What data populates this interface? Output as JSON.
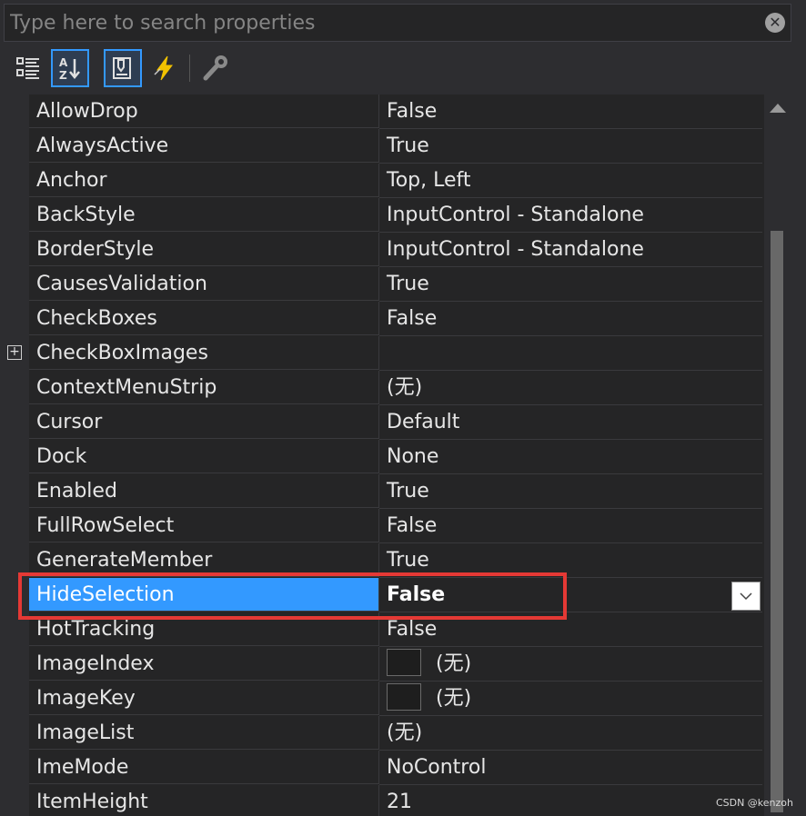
{
  "search": {
    "placeholder": "Type here to search properties"
  },
  "toolbar": {
    "buttons": [
      {
        "icon": "categorized-icon",
        "active": false
      },
      {
        "icon": "alphabetical-sort-icon",
        "active": true
      },
      {
        "icon": "properties-icon",
        "active": true
      },
      {
        "icon": "events-lightning-icon",
        "active": false
      },
      {
        "icon": "property-pages-wrench-icon",
        "active": false
      }
    ]
  },
  "properties": [
    {
      "name": "AllowDrop",
      "value": "False"
    },
    {
      "name": "AlwaysActive",
      "value": "True"
    },
    {
      "name": "Anchor",
      "value": "Top, Left"
    },
    {
      "name": "BackStyle",
      "value": "InputControl - Standalone"
    },
    {
      "name": "BorderStyle",
      "value": "InputControl - Standalone"
    },
    {
      "name": "CausesValidation",
      "value": "True"
    },
    {
      "name": "CheckBoxes",
      "value": "False"
    },
    {
      "name": "CheckBoxImages",
      "value": "",
      "expandable": true
    },
    {
      "name": "ContextMenuStrip",
      "value": "(无)"
    },
    {
      "name": "Cursor",
      "value": "Default"
    },
    {
      "name": "Dock",
      "value": "None"
    },
    {
      "name": "Enabled",
      "value": "True"
    },
    {
      "name": "FullRowSelect",
      "value": "False"
    },
    {
      "name": "GenerateMember",
      "value": "True"
    },
    {
      "name": "HideSelection",
      "value": "False",
      "selected": true
    },
    {
      "name": "HotTracking",
      "value": "False"
    },
    {
      "name": "ImageIndex",
      "value": "(无)",
      "swatch": true
    },
    {
      "name": "ImageKey",
      "value": "(无)",
      "swatch": true
    },
    {
      "name": "ImageList",
      "value": "(无)"
    },
    {
      "name": "ImeMode",
      "value": "NoControl"
    },
    {
      "name": "ItemHeight",
      "value": "21"
    }
  ],
  "watermark": "CSDN @kenzoh",
  "colors": {
    "selection": "#3399ff",
    "highlight_border": "#e53935",
    "background": "#252526"
  }
}
